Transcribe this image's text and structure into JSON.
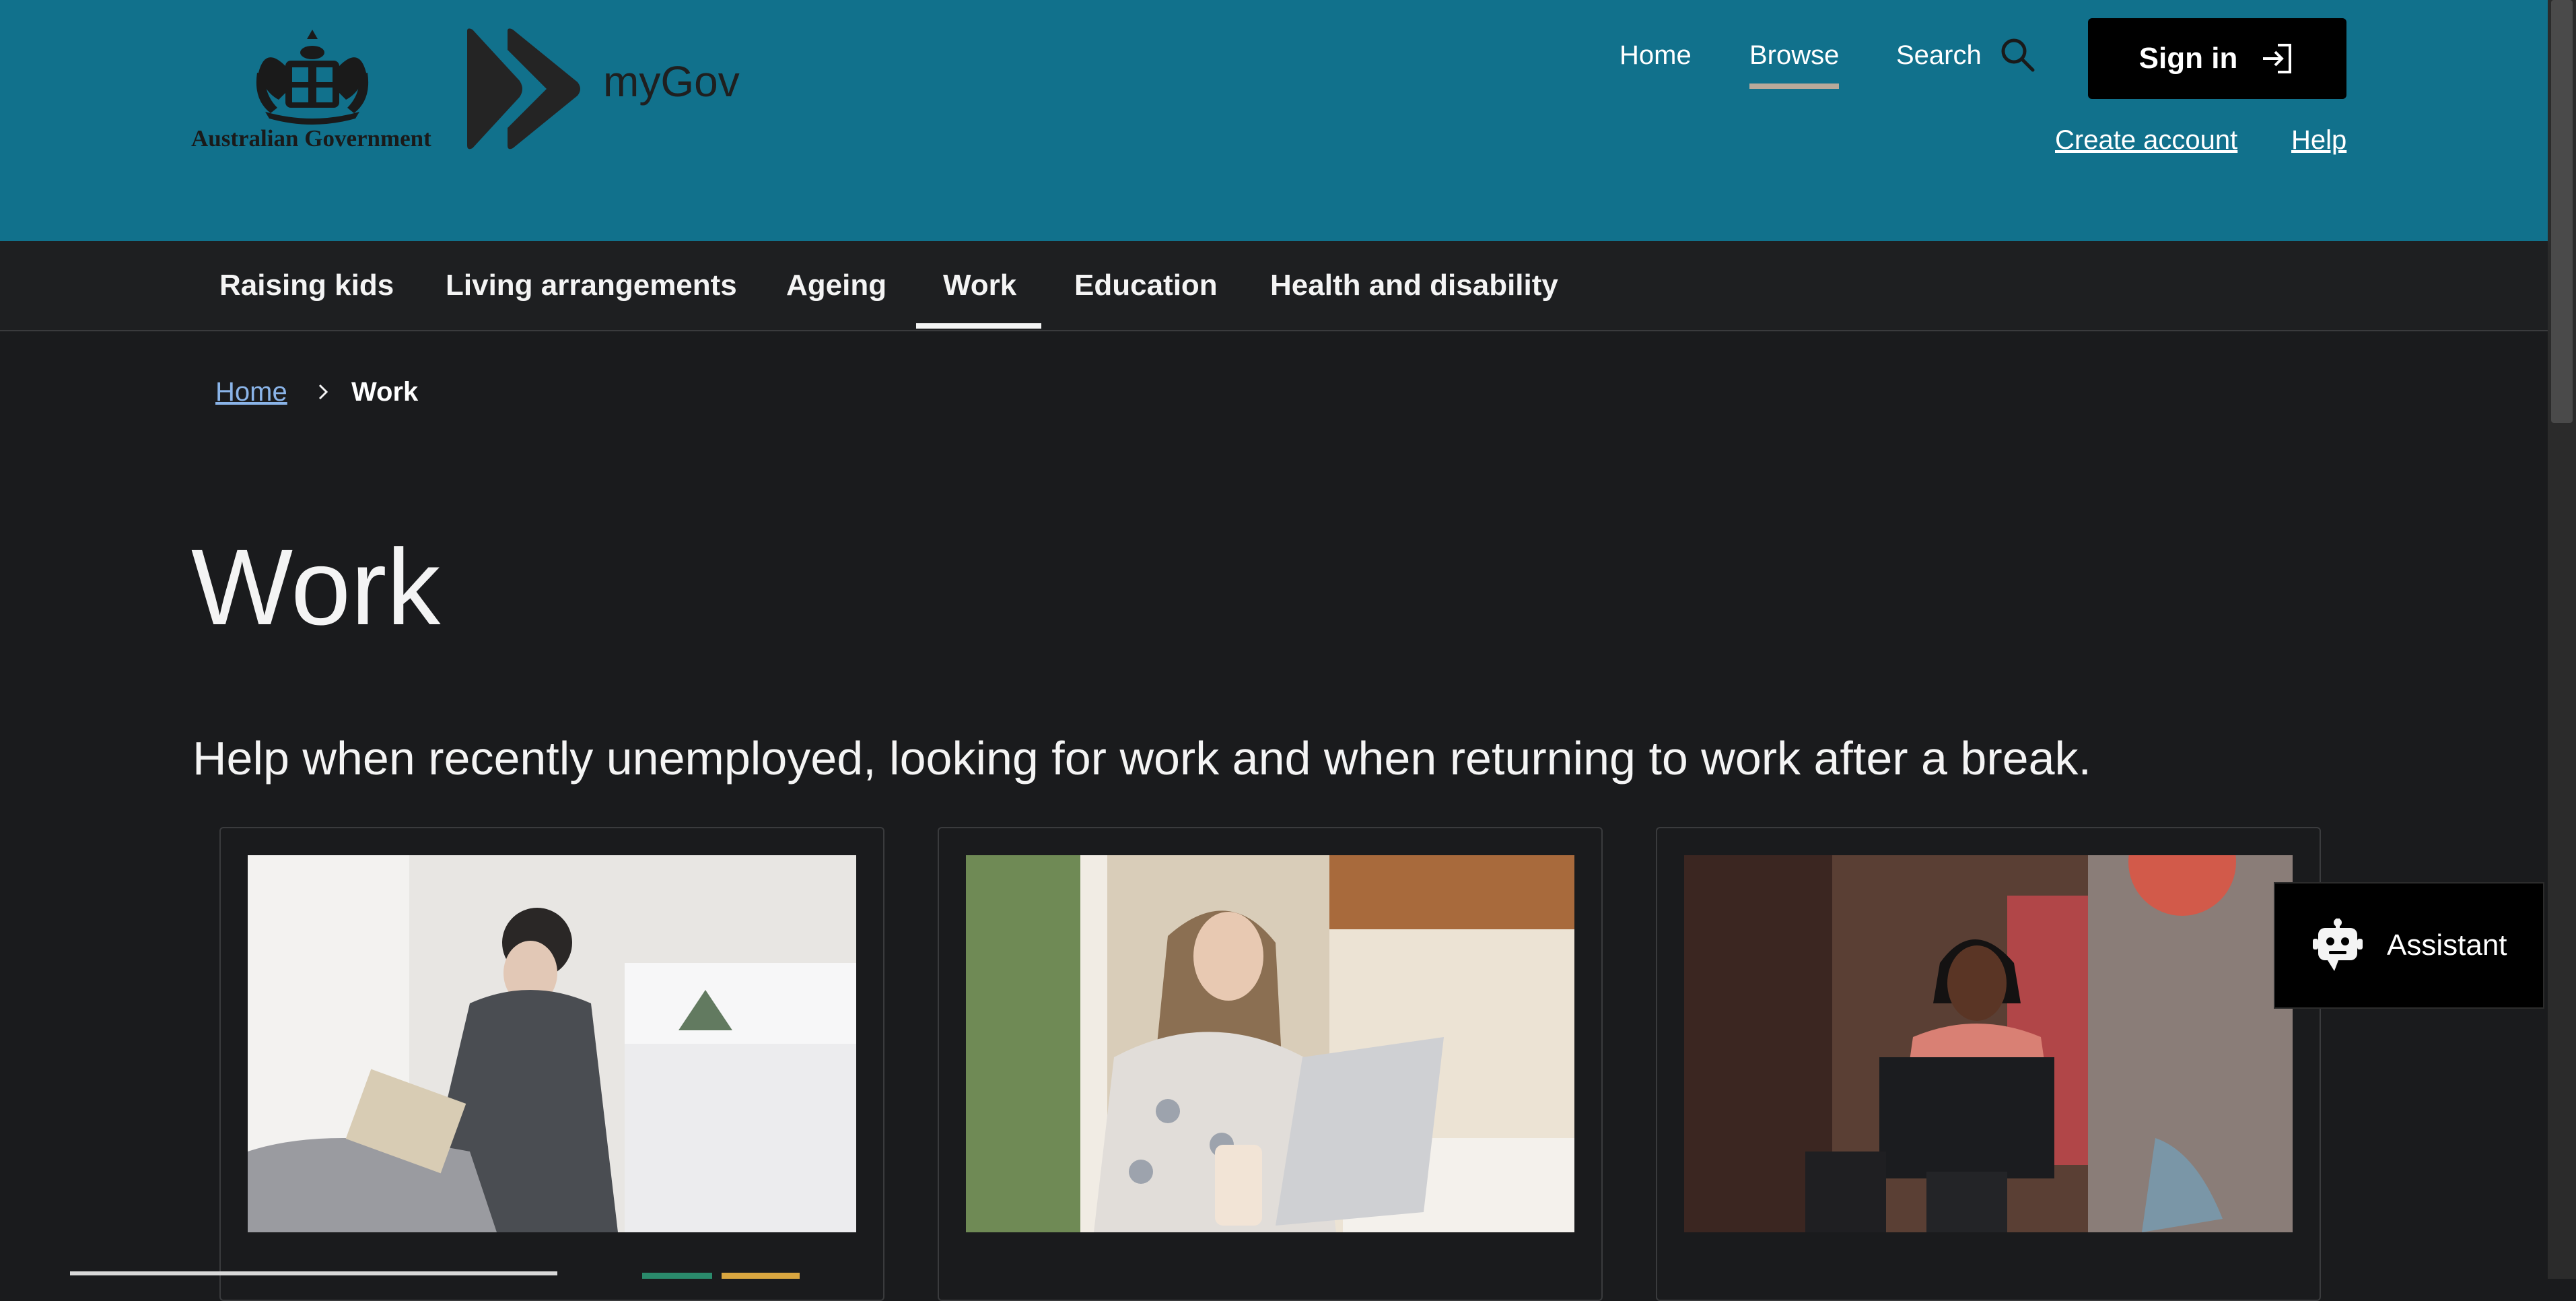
{
  "header": {
    "gov_label": "Australian Government",
    "brand": "myGov",
    "nav": {
      "home": "Home",
      "browse": "Browse",
      "search": "Search"
    },
    "sign_in": "Sign in",
    "create_account": "Create account",
    "help": "Help"
  },
  "subnav": {
    "items": [
      {
        "label": "Raising kids"
      },
      {
        "label": "Living arrangements"
      },
      {
        "label": "Ageing"
      },
      {
        "label": "Work"
      },
      {
        "label": "Education"
      },
      {
        "label": "Health and disability"
      }
    ],
    "active": "Work"
  },
  "breadcrumb": {
    "home": "Home",
    "current": "Work"
  },
  "page": {
    "title": "Work",
    "intro": "Help when recently unemployed, looking for work and when returning to work after a break."
  },
  "cards": [
    {
      "image": "woman-writing-notebook-photo"
    },
    {
      "image": "woman-using-laptop-photo"
    },
    {
      "image": "cafe-worker-at-register-photo"
    }
  ],
  "assistant": {
    "label": "Assistant"
  },
  "colors": {
    "header_bg": "#11718c",
    "body_bg": "#1a1b1d",
    "link": "#8ab4e8",
    "button_bg": "#000000"
  }
}
